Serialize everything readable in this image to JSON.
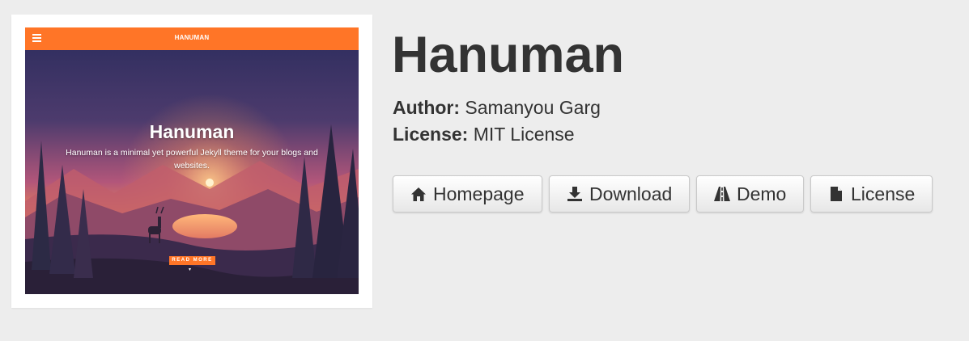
{
  "preview": {
    "brand": "HANUMAN",
    "title": "Hanuman",
    "description": "Hanuman is a minimal yet powerful Jekyll theme for your blogs and websites.",
    "button": "READ MORE",
    "chevron": "▾"
  },
  "theme": {
    "name": "Hanuman",
    "author_label": "Author:",
    "author": "Samanyou Garg",
    "license_label": "License:",
    "license": "MIT License"
  },
  "buttons": {
    "homepage": "Homepage",
    "download": "Download",
    "demo": "Demo",
    "license": "License"
  },
  "colors": {
    "page_background": "#ededed",
    "preview_accent": "#ff7527",
    "text": "#333333"
  },
  "icons": {
    "homepage": "home-icon",
    "download": "download-icon",
    "demo": "road-icon",
    "license": "file-icon"
  }
}
